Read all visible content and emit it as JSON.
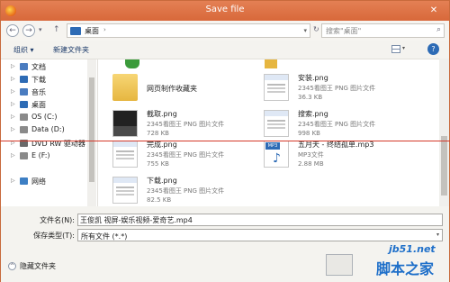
{
  "window": {
    "title": "Save file",
    "close_glyph": "✕"
  },
  "address_bar": {
    "back_glyph": "←",
    "forward_glyph": "→",
    "up_glyph": "↑",
    "recent_glyph": "▾",
    "breadcrumb": "桌面",
    "separator": "›",
    "dropdown_glyph": "▾",
    "refresh_glyph": "↻",
    "search_placeholder": "搜索\"桌面\"",
    "search_icon": "search-icon"
  },
  "toolbar": {
    "organize_label": "组织 ▾",
    "new_folder_label": "新建文件夹",
    "view_dropdown_glyph": "▾",
    "help_glyph": "?"
  },
  "nav_tree": [
    {
      "label": "文档",
      "icon": "document-folder-icon",
      "color": "#4a7cc0"
    },
    {
      "label": "下载",
      "icon": "download-folder-icon",
      "color": "#2d6bb5"
    },
    {
      "label": "音乐",
      "icon": "music-folder-icon",
      "color": "#4a7cc0"
    },
    {
      "label": "桌面",
      "icon": "desktop-folder-icon",
      "color": "#2d6bb5"
    },
    {
      "label": "OS (C:)",
      "icon": "drive-icon",
      "color": "#8a8a8a"
    },
    {
      "label": "Data (D:)",
      "icon": "drive-icon",
      "color": "#8a8a8a"
    },
    {
      "label": "DVD RW 驱动器",
      "icon": "dvd-drive-icon",
      "color": "#6a6a6a"
    },
    {
      "label": "E (F:)",
      "icon": "drive-icon",
      "color": "#8a8a8a"
    },
    {
      "label": "网络",
      "icon": "network-icon",
      "color": "#3d7fc4"
    }
  ],
  "files": [
    {
      "name": "网页制作收藏夹",
      "type": "",
      "size": "",
      "thumb": "folder"
    },
    {
      "name": "安装.png",
      "type": "2345看图王 PNG 图片文件",
      "size": "36.3 KB",
      "thumb": "web"
    },
    {
      "name": "截取.png",
      "type": "2345看图王 PNG 图片文件",
      "size": "728 KB",
      "thumb": "dark"
    },
    {
      "name": "搜索.png",
      "type": "2345看图王 PNG 图片文件",
      "size": "998 KB",
      "thumb": "web"
    },
    {
      "name": "完成.png",
      "type": "2345看图王 PNG 图片文件",
      "size": "755 KB",
      "thumb": "web"
    },
    {
      "name": "五月天 - 终结孤单.mp3",
      "type": "MP3文件",
      "size": "2.88 MB",
      "thumb": "mp3"
    },
    {
      "name": "下载.png",
      "type": "2345看图王 PNG 图片文件",
      "size": "82.5 KB",
      "thumb": "web"
    }
  ],
  "form": {
    "filename_label": "文件名(N):",
    "filename_value": "王俊凯 视屏-娱乐视频-爱奇艺.mp4",
    "filetype_label": "保存类型(T):",
    "filetype_value": "所有文件 (*.*)",
    "hide_folders_label": "隐藏文件夹"
  },
  "mp3_tag": "MP3",
  "watermark": {
    "site": "jb51.net",
    "brand": "脚本之家"
  },
  "colors": {
    "titlebar": "#d8683a",
    "accent": "#2d6bb5",
    "annotation_line": "#d43a2a"
  }
}
